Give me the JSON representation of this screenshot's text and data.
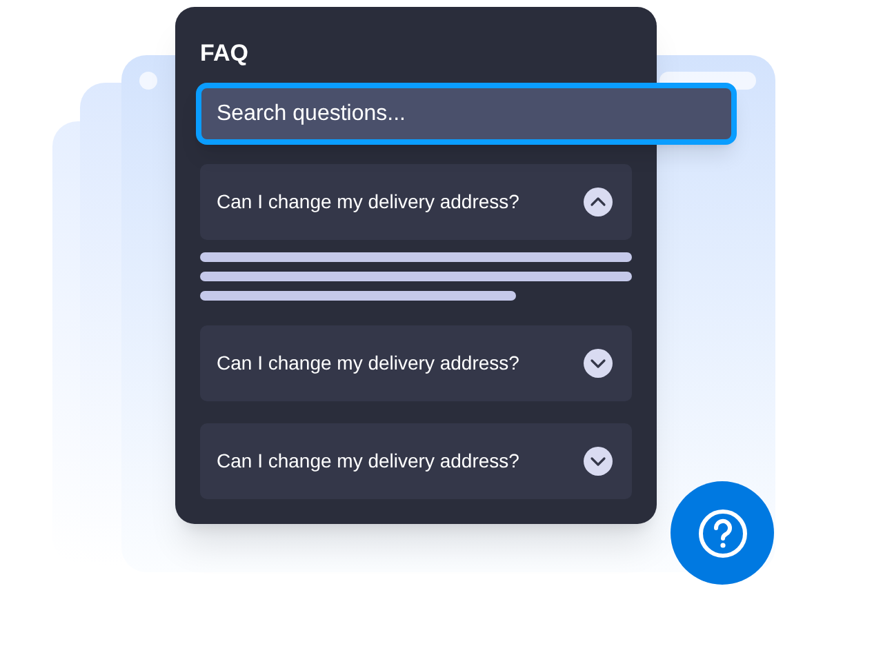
{
  "faq": {
    "title": "FAQ",
    "search": {
      "placeholder": "Search questions..."
    },
    "items": [
      {
        "question": "Can I change my delivery address?",
        "expanded": true
      },
      {
        "question": "Can I change my delivery address?",
        "expanded": false
      },
      {
        "question": "Can I change my delivery address?",
        "expanded": false
      }
    ]
  }
}
